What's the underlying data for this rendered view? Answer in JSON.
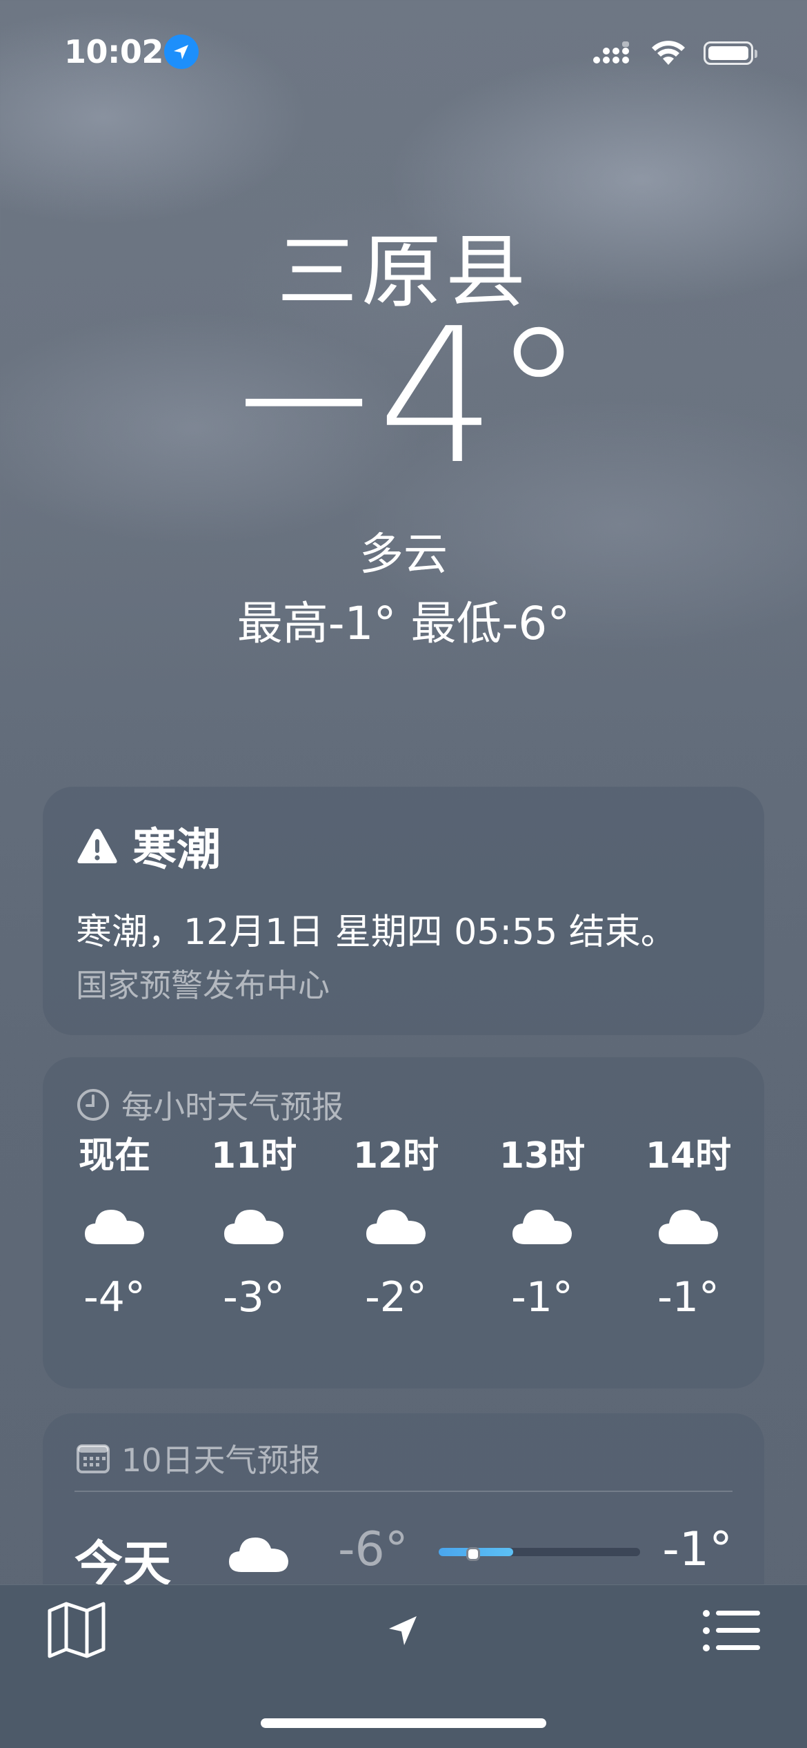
{
  "status_bar": {
    "time": "10:02"
  },
  "hero": {
    "city": "三原县",
    "temperature": "−4°",
    "condition": "多云",
    "high_low": "最高-1°  最低-6°"
  },
  "alert": {
    "title": "寒潮",
    "text": "寒潮，12月1日 星期四 05:55 结束。",
    "source": "国家预警发布中心"
  },
  "hourly": {
    "heading": "每小时天气预报",
    "items": [
      {
        "label": "现在",
        "icon": "cloud-icon",
        "temp": "-4°"
      },
      {
        "label": "11时",
        "icon": "cloud-icon",
        "temp": "-3°"
      },
      {
        "label": "12时",
        "icon": "cloud-icon",
        "temp": "-2°"
      },
      {
        "label": "13时",
        "icon": "cloud-icon",
        "temp": "-1°"
      },
      {
        "label": "14时",
        "icon": "cloud-icon",
        "temp": "-1°"
      }
    ]
  },
  "daily": {
    "heading": "10日天气预报",
    "rows": [
      {
        "day": "今天",
        "icon": "cloud-icon",
        "low": "-6°",
        "high": "-1°"
      }
    ]
  },
  "colors": {
    "location_badge": "#1d8ffb",
    "range_bar": "#4aa6ee"
  }
}
